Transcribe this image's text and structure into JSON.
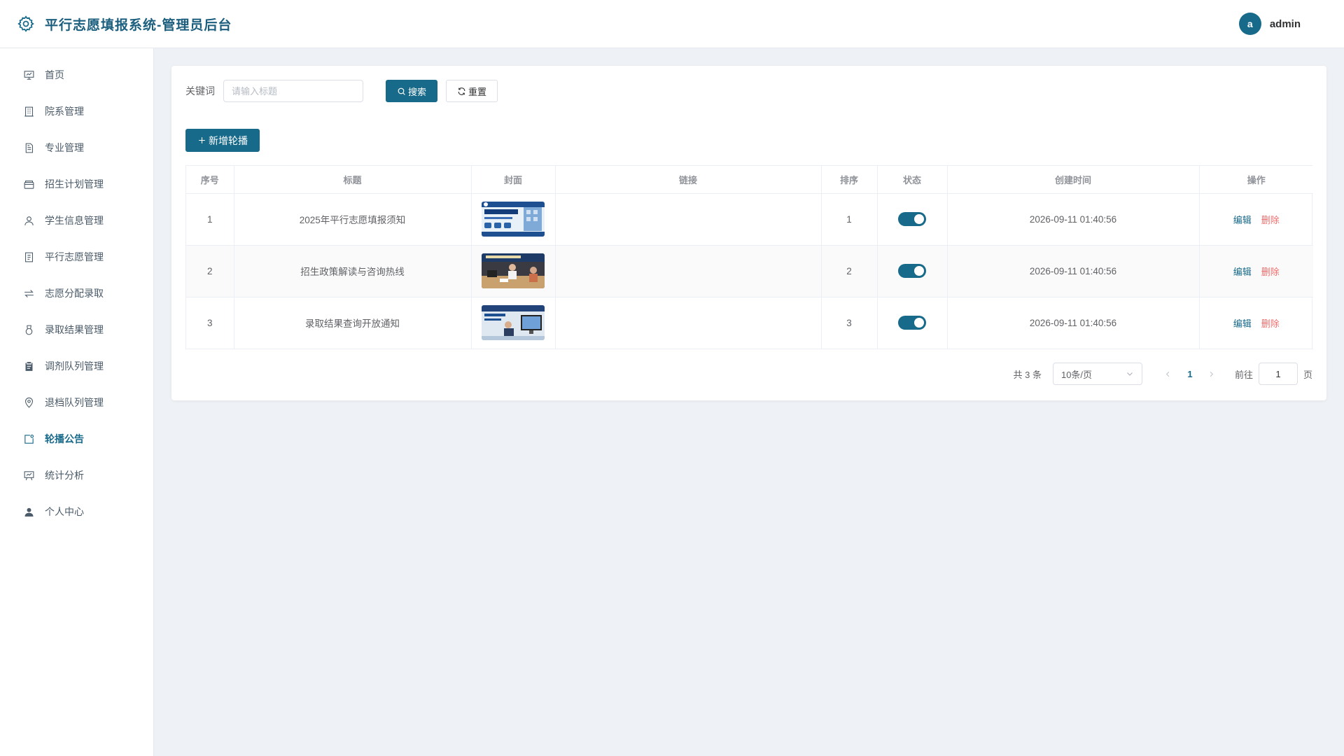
{
  "header": {
    "title": "平行志愿填报系统-管理员后台",
    "avatar_letter": "a",
    "username": "admin",
    "brand_color": "#186a8a"
  },
  "sidebar": {
    "items": [
      {
        "label": "首页",
        "icon": "dashboard-icon",
        "active": false
      },
      {
        "label": "院系管理",
        "icon": "building-icon",
        "active": false
      },
      {
        "label": "专业管理",
        "icon": "document-icon",
        "active": false
      },
      {
        "label": "招生计划管理",
        "icon": "wallet-icon",
        "active": false
      },
      {
        "label": "学生信息管理",
        "icon": "user-icon",
        "active": false
      },
      {
        "label": "平行志愿管理",
        "icon": "tickets-icon",
        "active": false
      },
      {
        "label": "志愿分配录取",
        "icon": "switch-icon",
        "active": false
      },
      {
        "label": "录取结果管理",
        "icon": "medal-icon",
        "active": false
      },
      {
        "label": "调剂队列管理",
        "icon": "clipboard-icon",
        "active": false
      },
      {
        "label": "退档队列管理",
        "icon": "location-icon",
        "active": false
      },
      {
        "label": "轮播公告",
        "icon": "notice-icon",
        "active": true
      },
      {
        "label": "统计分析",
        "icon": "presentation-icon",
        "active": false
      },
      {
        "label": "个人中心",
        "icon": "user-filled-icon",
        "active": false
      }
    ]
  },
  "search": {
    "label": "关键词",
    "placeholder": "请输入标题",
    "value": "",
    "search_label": "搜索",
    "reset_label": "重置"
  },
  "toolbar": {
    "add_label": "新增轮播"
  },
  "table": {
    "columns": [
      "序号",
      "标题",
      "封面",
      "链接",
      "排序",
      "状态",
      "创建时间",
      "操作"
    ],
    "rows": [
      {
        "index": "1",
        "title": "2025年平行志愿填报须知",
        "cover": "banner-cover-image",
        "link": "",
        "order": "1",
        "enabled": true,
        "created": "2026-09-11 01:40:56"
      },
      {
        "index": "2",
        "title": "招生政策解读与咨询热线",
        "cover": "consultation-cover-image",
        "link": "",
        "order": "2",
        "enabled": true,
        "created": "2026-09-11 01:40:56"
      },
      {
        "index": "3",
        "title": "录取结果查询开放通知",
        "cover": "results-cover-image",
        "link": "",
        "order": "3",
        "enabled": true,
        "created": "2026-09-11 01:40:56"
      }
    ],
    "edit_label": "编辑",
    "delete_label": "删除"
  },
  "pagination": {
    "total_text": "共 3 条",
    "page_size": "10条/页",
    "current_page": "1",
    "goto_label": "前往",
    "goto_value": "1",
    "goto_suffix": "页"
  }
}
